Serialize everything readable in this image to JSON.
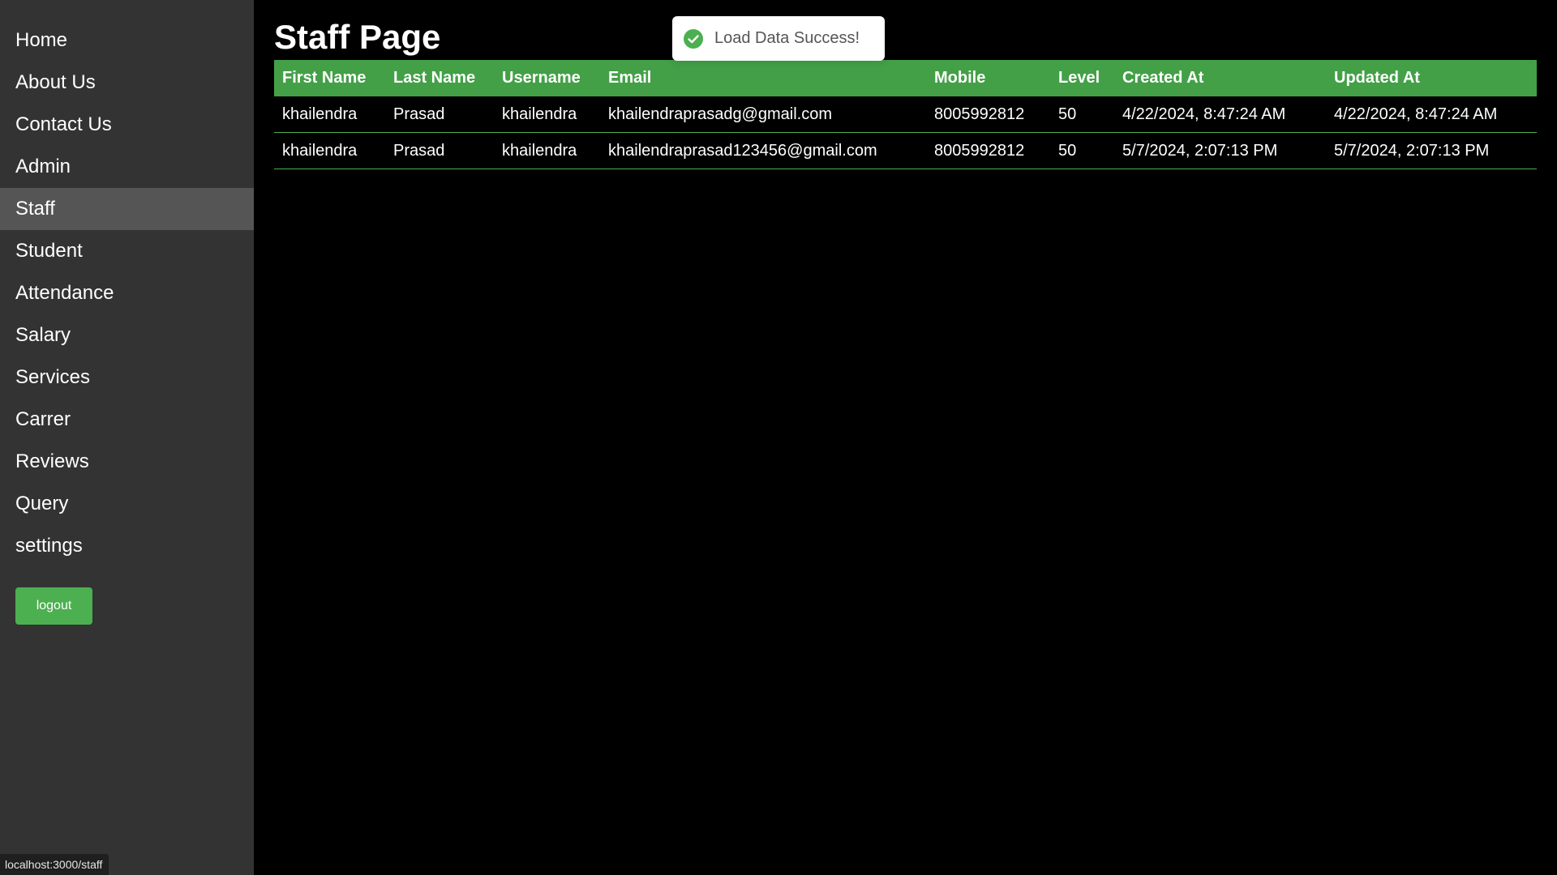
{
  "sidebar": {
    "items": [
      {
        "label": "Home"
      },
      {
        "label": "About Us"
      },
      {
        "label": "Contact Us"
      },
      {
        "label": "Admin"
      },
      {
        "label": "Staff"
      },
      {
        "label": "Student"
      },
      {
        "label": "Attendance"
      },
      {
        "label": "Salary"
      },
      {
        "label": "Services"
      },
      {
        "label": "Carrer"
      },
      {
        "label": "Reviews"
      },
      {
        "label": "Query"
      },
      {
        "label": "settings"
      }
    ],
    "active": "Staff",
    "logout_label": "logout"
  },
  "main": {
    "title": "Staff Page"
  },
  "table": {
    "headers": [
      "First Name",
      "Last Name",
      "Username",
      "Email",
      "Mobile",
      "Level",
      "Created At",
      "Updated At"
    ],
    "rows": [
      [
        "khailendra",
        "Prasad",
        "khailendra",
        "khailendraprasadg@gmail.com",
        "8005992812",
        "50",
        "4/22/2024, 8:47:24 AM",
        "4/22/2024, 8:47:24 AM"
      ],
      [
        "khailendra",
        "Prasad",
        "khailendra",
        "khailendraprasad123456@gmail.com",
        "8005992812",
        "50",
        "5/7/2024, 2:07:13 PM",
        "5/7/2024, 2:07:13 PM"
      ]
    ]
  },
  "toast": {
    "message": "Load Data Success!",
    "icon": "check-circle-icon"
  },
  "status_bar": {
    "url": "localhost:3000/staff"
  },
  "colors": {
    "sidebar_bg": "#333333",
    "active_item_bg": "#555555",
    "accent": "#43a047",
    "button": "#4caf50",
    "success_icon": "#4caf50"
  }
}
